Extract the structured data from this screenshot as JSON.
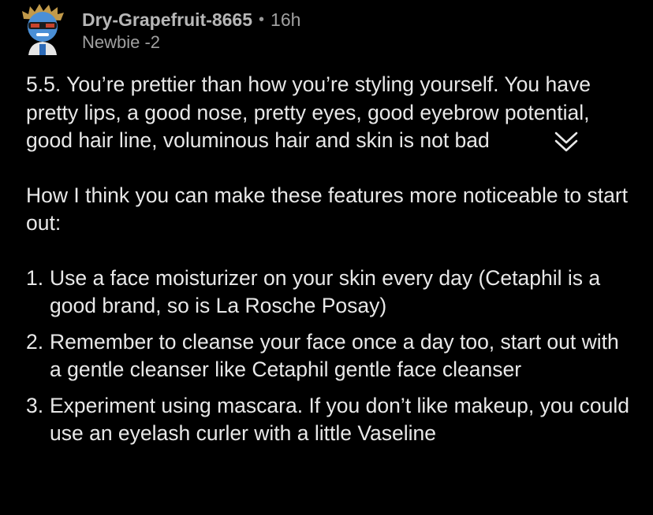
{
  "comment": {
    "username": "Dry-Grapefruit-8665",
    "separator": "•",
    "time": "16h",
    "flair": "Newbie -2",
    "paragraphs": [
      "5.5. You’re prettier than how you’re styling yourself. You have pretty lips, a good nose, pretty eyes, good eyebrow potential, good hair line, voluminous hair and skin is not bad",
      "How I think you can make these features more noticeable to start out:"
    ],
    "list": [
      {
        "num": "1.",
        "text": "Use a face moisturizer on your skin every day (Cetaphil is a good brand, so is La Rosche Posay)"
      },
      {
        "num": "2.",
        "text": "Remember to cleanse your face once a day too, start out with a gentle cleanser like Cetaphil gentle face cleanser"
      },
      {
        "num": "3.",
        "text": "Experiment using mascara. If you don’t like makeup, you could use an eyelash curler with a little Vaseline"
      }
    ],
    "collapse_icon": "double-chevron-down-icon"
  }
}
